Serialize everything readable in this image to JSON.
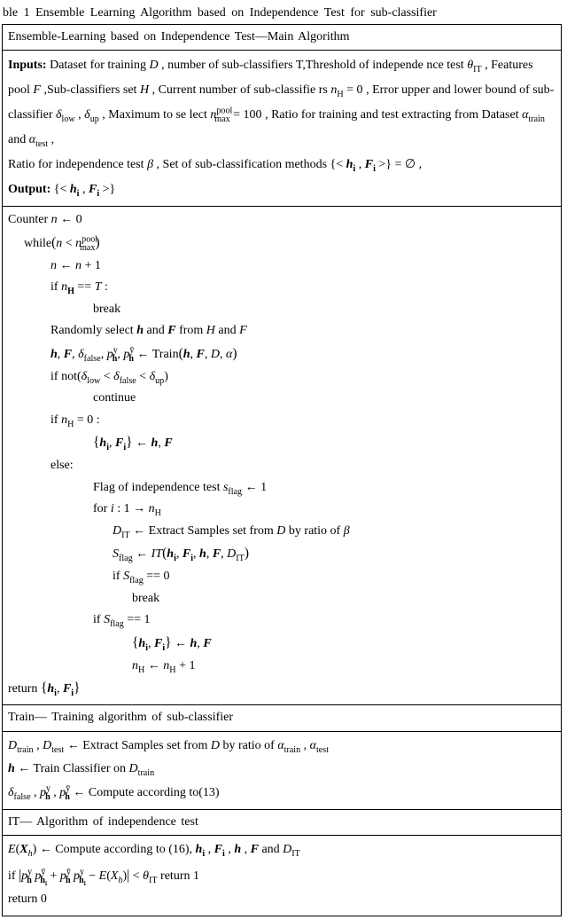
{
  "title": "ble 1 Ensemble Learning Algorithm based on Independence Test for sub-classifier",
  "section_main_head": "Ensemble-Learning based on Independence Test—Main Algorithm",
  "inputs_label": "Inputs:",
  "inputs_text_1": " Dataset for training ",
  "sym_D": "D",
  "inputs_text_2": " , number of sub-classifiers T,Threshold of independe",
  "inputs_line2a": "nce test ",
  "theta_IT": "θ",
  "theta_IT_sub": "IT",
  "inputs_line2b": " , Features pool ",
  "sym_F": "F",
  "inputs_line2c": " ,Sub-classifiers set ",
  "sym_H": "H",
  "inputs_line2d": " , Current number of sub-classifie",
  "inputs_line3a": "rs ",
  "nH": "n",
  "nH_sub": "H",
  "eq0": " = 0",
  "inputs_line3b": " , Error upper and lower bound of sub-classifier ",
  "delta_low": "δ",
  "delta_low_sub": "low",
  "delta_up": "δ",
  "delta_up_sub": "up",
  "inputs_line3c": " , Maximum to se",
  "inputs_line4a": "lect ",
  "npool": "n",
  "npool_sup": "pool",
  "npool_sub": "max",
  "eq100": " = 100",
  "inputs_line4b": " , Ratio for training and test extracting from Dataset ",
  "alpha_train": "α",
  "alpha_train_sub": "train",
  "and_word": " and ",
  "alpha_test": "α",
  "alpha_test_sub": "test",
  "inputs_line4c": " , ",
  "inputs_line5a": "Ratio for independence test ",
  "beta": "β",
  "inputs_line5b": " , Set of sub-classification methods ",
  "set_open": "{< ",
  "h_i": "h",
  "sub_i": "i",
  "F_i": "F",
  "set_mid": " , ",
  "set_close": " >} = ∅ ,",
  "output_label": "Output:",
  "output_set": " {< ",
  "output_close": " >}",
  "counter_line": "Counter   ",
  "n_var": "n",
  "larr": " ← 0",
  "while_kw": "while",
  "while_cond_open": "(",
  "lt": " < ",
  "while_cond_close": ")",
  "n_inc_lhs": "n",
  "n_inc": " ← ",
  "n_inc_rhs_a": "n",
  "n_inc_rhs_b": " + 1",
  "if_kw": "if  ",
  "eqeq": " == ",
  "T_var": "T",
  "colon": " :",
  "break_kw": "break",
  "rand_sel_a": "Randomly select  ",
  "h_bold": "h",
  "rand_sel_b": "  and  ",
  "F_bold": "F",
  "rand_sel_c": "  from  ",
  "rand_sel_d": "  and  ",
  "train_lhs_sep": ", ",
  "delta_false": "δ",
  "delta_false_sub": "false",
  "p_yh": "p",
  "p_yh_sup": "y",
  "p_yh_sub": "h",
  "p_ybarh": "p",
  "p_ybarh_sup": "ȳ",
  "p_ybarh_sub": "h",
  "train_arrow": " ← Train",
  "train_args_open": "(",
  "train_args_close": ")",
  "alpha_plain": "α",
  "not_kw": "not(",
  "not_cond_b": " < ",
  "not_close": ")",
  "continue_kw": "continue",
  "eq0_colon": " = 0 :",
  "set_assign_l": "{",
  "set_assign_r": "}",
  "set_assign_arrow": " ← ",
  "else_kw": "else:",
  "flag_text": "Flag of independence test  ",
  "s_flag": "s",
  "s_flag_sub": "flag",
  "flag_arrow_1": " ← 1",
  "for_kw": "for  ",
  "for_i": "i",
  "for_range": " : 1 → ",
  "DIT": "D",
  "DIT_sub": "IT",
  "extract_text": " ← Extract Samples set from  ",
  "by_ratio": "  by ratio of  ",
  "S_flag": "S",
  "S_flag_sub": "flag",
  "IT_arrow": " ← ",
  "IT_call": "IT",
  "IT_args_open": "(",
  "IT_args_close": ")",
  "eq0_plain": " == 0",
  "eq1_plain": " == 1",
  "nH_inc_b": " + 1",
  "return_kw": "return  ",
  "section_train_head": "Train— Training algorithm of sub-classifier",
  "Dtrain": "D",
  "Dtrain_sub": "train",
  "Dtest": "D",
  "Dtest_sub": "test",
  "train_extract": " ← Extract Samples set from  ",
  "by_ratio2": "  by ratio of  ",
  "h_train_line": " ← Train Classifier on  ",
  "compute13": " ← Compute according to(13)",
  "section_it_head": "IT— Algorithm of independence test",
  "E_open": "E",
  "X_h": "X",
  "X_h_sub": "h",
  "compute16": " ← Compute according to (16), ",
  "and_sym": " and ",
  "if_abs_open": "|",
  "minus": " − ",
  "abs_close": "|",
  "lt2": " < ",
  "ret1": " return  1",
  "ret0": "return  0",
  "p_sub_hi": "h",
  "p_sub_hi_i": "i",
  "comma": " , "
}
